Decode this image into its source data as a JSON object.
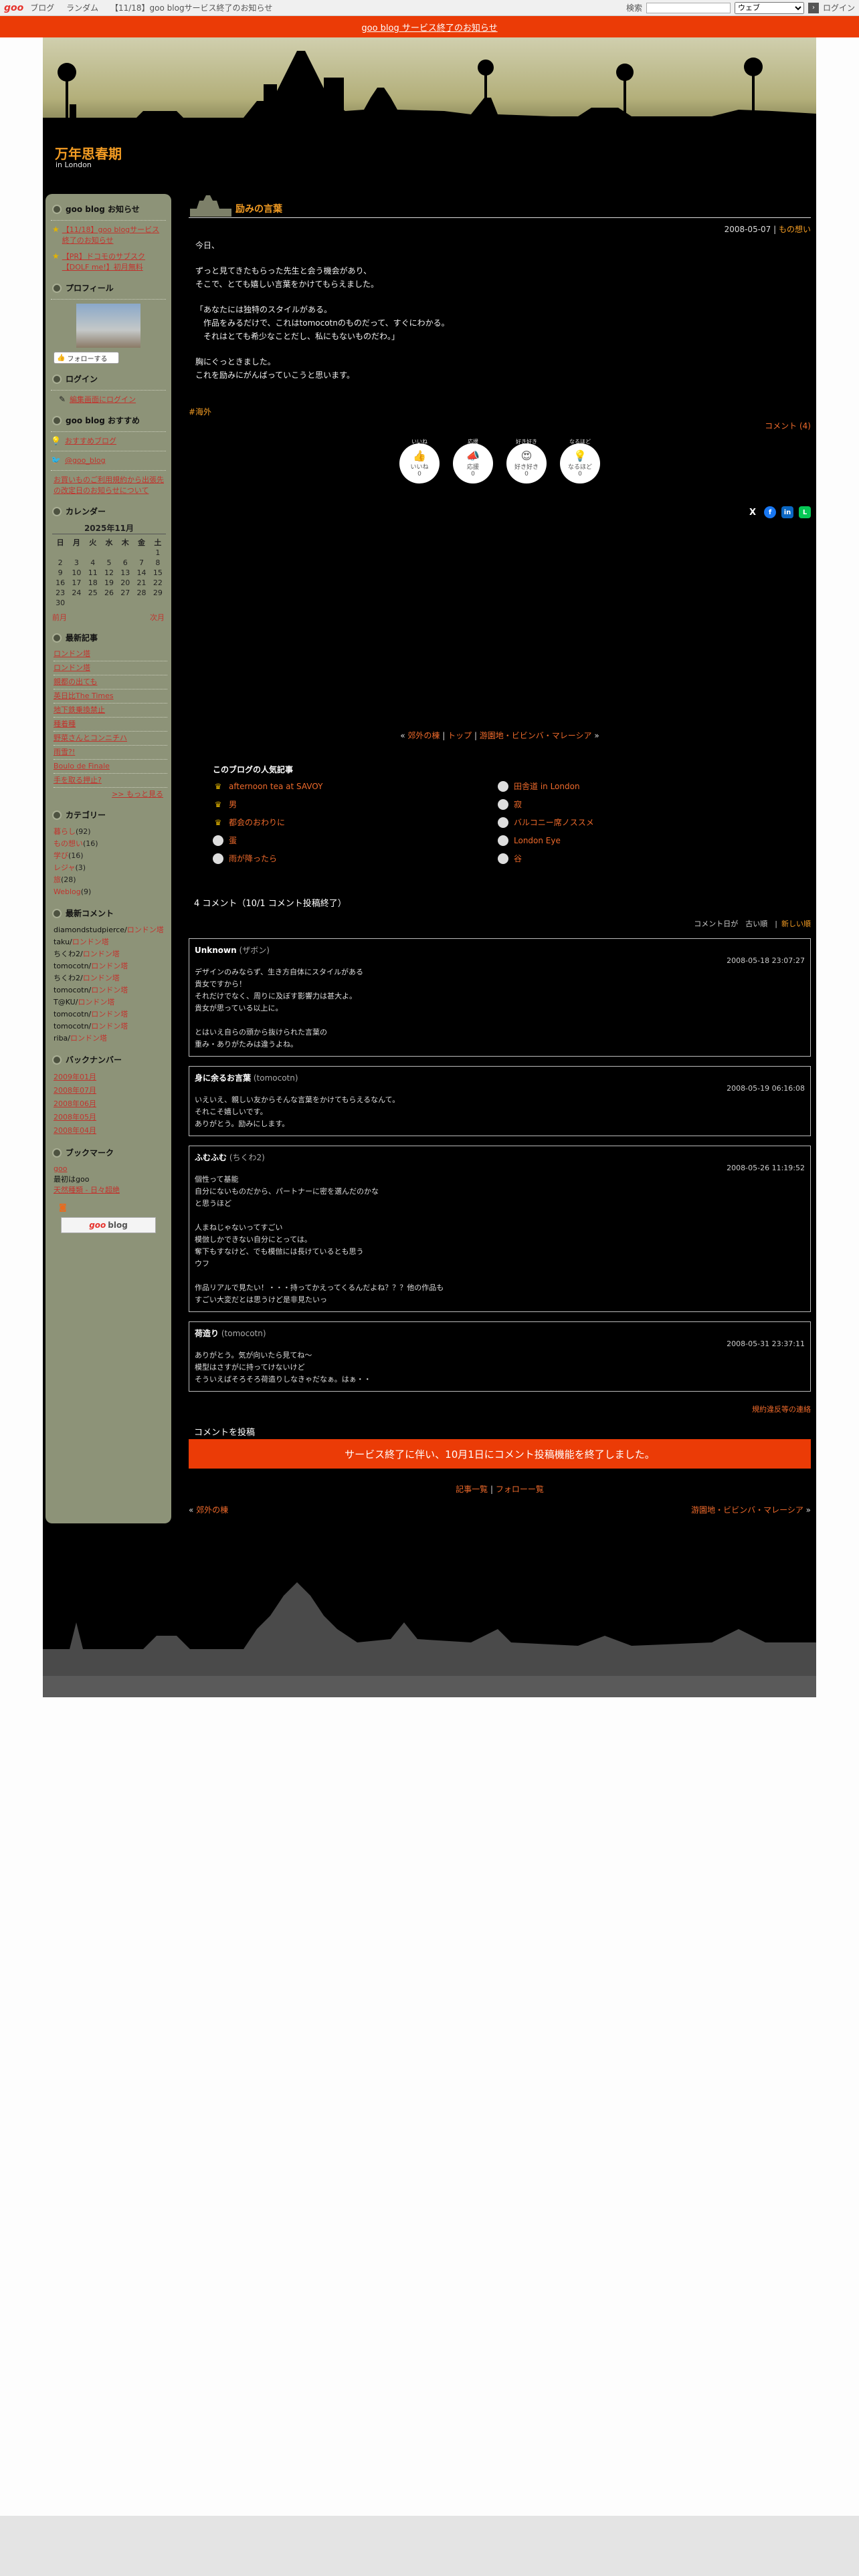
{
  "topbar": {
    "logo": "goo",
    "nav": [
      "ブログ",
      "ランダム",
      "【11/18】goo blogサービス終了のお知らせ"
    ],
    "search_label": "検索",
    "search_select": "ウェブ",
    "login": "ログイン"
  },
  "banner": {
    "text": "goo blog サービス終了のお知らせ"
  },
  "blog": {
    "title": "万年思春期",
    "subtitle": "in London"
  },
  "sidebar": {
    "notice": {
      "heading": "goo blog お知らせ",
      "items": [
        "【11/18】goo blogサービス終了のお知らせ",
        "【PR】ドコモのサブスク【DOLF me!】初月無料"
      ]
    },
    "profile": {
      "heading": "プロフィール",
      "follow": "フォローする"
    },
    "login": {
      "heading": "ログイン",
      "link": "編集画面にログイン"
    },
    "recommend": {
      "heading": "goo blog おすすめ",
      "link1": "おすすめブログ",
      "link2": "@goo_blog",
      "link3": "お買いものご利用規約から出張先の改定日のお知らせについて"
    },
    "calendar": {
      "heading": "カレンダー",
      "caption": "2025年11月",
      "days": [
        "日",
        "月",
        "火",
        "水",
        "木",
        "金",
        "土"
      ],
      "weeks": [
        [
          "",
          "",
          "",
          "",
          "",
          "",
          "1"
        ],
        [
          "2",
          "3",
          "4",
          "5",
          "6",
          "7",
          "8"
        ],
        [
          "9",
          "10",
          "11",
          "12",
          "13",
          "14",
          "15"
        ],
        [
          "16",
          "17",
          "18",
          "19",
          "20",
          "21",
          "22"
        ],
        [
          "23",
          "24",
          "25",
          "26",
          "27",
          "28",
          "29"
        ],
        [
          "30",
          "",
          "",
          "",
          "",
          "",
          ""
        ]
      ],
      "prev": "前月",
      "next": "次月"
    },
    "recent": {
      "heading": "最新記事",
      "items": [
        "ロンドン塔",
        "ロンドン塔",
        "親都の出ても",
        "英日比The Times",
        "地下鉄乗換禁止",
        "種着種",
        "野菜さんとコンニチハ",
        "雨雪?!",
        "Boulo de Finale",
        "手を取る押止?"
      ],
      "more": ">> もっと見る"
    },
    "categories": {
      "heading": "カテゴリー",
      "items": [
        {
          "name": "暮らし",
          "count": "(92)"
        },
        {
          "name": "もの想い",
          "count": "(16)"
        },
        {
          "name": "学び",
          "count": "(16)"
        },
        {
          "name": "レジャ",
          "count": "(3)"
        },
        {
          "name": "旅",
          "count": "(28)"
        },
        {
          "name": "Weblog",
          "count": "(9)"
        }
      ]
    },
    "recent_comments": {
      "heading": "最新コメント",
      "items": [
        {
          "user": "diamondstudpierce/",
          "link": "ロンドン塔"
        },
        {
          "user": "taku/",
          "link": "ロンドン塔"
        },
        {
          "user": "ちくわ2/",
          "link": "ロンドン塔"
        },
        {
          "user": "tomocotn/",
          "link": "ロンドン塔"
        },
        {
          "user": "ちくわ2/",
          "link": "ロンドン塔"
        },
        {
          "user": "tomocotn/",
          "link": "ロンドン塔"
        },
        {
          "user": "T@KU/",
          "link": "ロンドン塔"
        },
        {
          "user": "tomocotn/",
          "link": "ロンドン塔"
        },
        {
          "user": "tomocotn/",
          "link": "ロンドン塔"
        },
        {
          "user": "riba/",
          "link": "ロンドン塔"
        }
      ]
    },
    "backnumber": {
      "heading": "バックナンバー",
      "items": [
        "2009年01月",
        "2008年07月",
        "2008年06月",
        "2008年05月",
        "2008年04月"
      ]
    },
    "bookmark": {
      "heading": "ブックマーク",
      "link": "goo",
      "text": "最初はgoo",
      "link2": "天然種類 - 日々超絶"
    },
    "goo_badge": "blog"
  },
  "entry": {
    "title": "励みの言葉",
    "date": "2008-05-07",
    "category": "もの想い",
    "paragraphs": [
      "今日、",
      "ずっと見てきたもらった先生と会う機会があり、\nそこで、とても嬉しい言葉をかけてもらえました。",
      "「あなたには独特のスタイルがある。\n　作品をみるだけで、これはtomocotnのものだって、すぐにわかる。\n　それはとても希少なことだし、私にもないものだわ。」",
      "胸にぐっときました。\nこれを励みにがんばっていこうと思います。"
    ],
    "tag": "#海外",
    "comments_link": "コメント (4)"
  },
  "reactions": [
    {
      "label": "いいね",
      "icon": "👍",
      "count": "0",
      "name": "like"
    },
    {
      "label": "応援",
      "icon": "📣",
      "count": "0",
      "name": "cheer"
    },
    {
      "label": "好き好き",
      "icon": "😍",
      "count": "0",
      "name": "love"
    },
    {
      "label": "なるほど",
      "icon": "💡",
      "count": "0",
      "name": "insight"
    }
  ],
  "share": [
    "X",
    "f",
    "in",
    "L"
  ],
  "pager": {
    "prev": "郊外の棟",
    "top": "トップ",
    "next": "游園地・ビビンバ・マレーシア"
  },
  "popular": {
    "heading": "このブログの人気記事",
    "items": [
      {
        "title": "afternoon tea at SAVOY",
        "rank": "crown"
      },
      {
        "title": "田舎道 in London",
        "rank": "ball"
      },
      {
        "title": "男",
        "rank": "crown"
      },
      {
        "title": "寂",
        "rank": "ball"
      },
      {
        "title": "都会のおわりに",
        "rank": "crown"
      },
      {
        "title": "バルコニー席ノススメ",
        "rank": "ball"
      },
      {
        "title": "蛋",
        "rank": "ball"
      },
      {
        "title": "London Eye",
        "rank": "ball"
      },
      {
        "title": "雨が降ったら",
        "rank": "ball"
      },
      {
        "title": "谷",
        "rank": "ball"
      }
    ]
  },
  "comments": {
    "heading": "4 コメント（10/1 コメント投稿終了）",
    "sort_label": "コメント日が　古い順　|",
    "sort_link": "新しい順",
    "items": [
      {
        "name": "Unknown",
        "handle": "(ザボン)",
        "date": "2008-05-18 23:07:27",
        "body": "デザインのみならず、生き方自体にスタイルがある\n貴女ですから！\nそれだけでなく、周りに及ぼす影響力は甚大よ。\n貴女が思っている以上に。\n\nとはいえ自らの頭から抜けられた言葉の\n重み・ありがたみは違うよね。"
      },
      {
        "name": "身に余るお言葉",
        "handle": "(tomocotn)",
        "date": "2008-05-19 06:16:08",
        "body": "いえいえ、親しい友からそんな言葉をかけてもらえるなんて。\nそれこそ嬉しいです。\nありがとう。励みにします。"
      },
      {
        "name": "ふむふむ",
        "handle": "(ちくわ2)",
        "date": "2008-05-26 11:19:52",
        "body": "個性って基能\n自分にないものだから、パートナーに密を選んだのかな\nと思うほど\n\n人まねじゃないってすごい\n模倣しかできない自分にとっては。\n奪下もすなけど、でも模倣には長けているとも思う\nウフ\n\n作品リアルで見たい！・・・持ってかえってくるんだよね？？？他の作品も\nすごい大変だとは思うけど是非見たいっ"
      },
      {
        "name": "荷造り",
        "handle": "(tomocotn)",
        "date": "2008-05-31 23:37:11",
        "body": "ありがとう。気が向いたら見てね〜\n模型はさすがに持ってけないけど\nそういえばそろそろ荷造りしなきゃだなぁ。はぁ・・"
      }
    ],
    "rules_link": "規約違反等の連絡",
    "post_heading": "コメントを投稿",
    "closed_notice": "サービス終了に伴い、10月1日にコメント投稿機能を終了しました。"
  },
  "bottom": {
    "list": "記事一覧",
    "follow": "フォローー覧",
    "prev": "郊外の棟",
    "next": "游園地・ビビンバ・マレーシア"
  }
}
